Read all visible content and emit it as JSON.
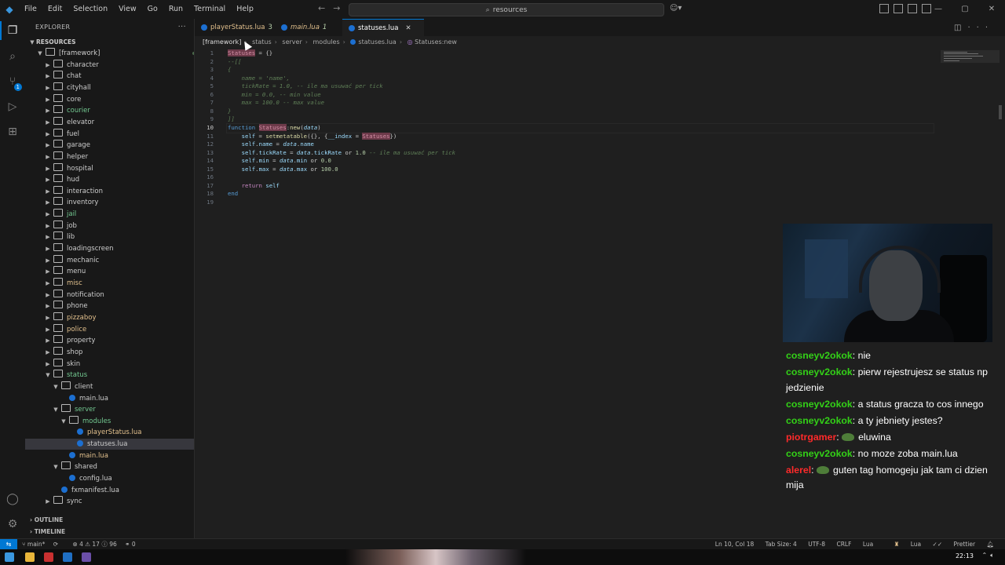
{
  "menu": [
    "File",
    "Edit",
    "Selection",
    "View",
    "Go",
    "Run",
    "Terminal",
    "Help"
  ],
  "command_center": {
    "label": "resources"
  },
  "explorer": {
    "title": "EXPLORER",
    "root": "RESOURCES",
    "items": [
      {
        "label": "[framework]",
        "type": "folder",
        "open": true,
        "depth": 1,
        "dot": true
      },
      {
        "label": "character",
        "type": "folder",
        "depth": 2
      },
      {
        "label": "chat",
        "type": "folder",
        "depth": 2
      },
      {
        "label": "cityhall",
        "type": "folder",
        "depth": 2
      },
      {
        "label": "core",
        "type": "folder",
        "depth": 2
      },
      {
        "label": "courier",
        "type": "folder",
        "depth": 2,
        "dot": true
      },
      {
        "label": "elevator",
        "type": "folder",
        "depth": 2
      },
      {
        "label": "fuel",
        "type": "folder",
        "depth": 2
      },
      {
        "label": "garage",
        "type": "folder",
        "depth": 2
      },
      {
        "label": "helper",
        "type": "folder",
        "depth": 2
      },
      {
        "label": "hospital",
        "type": "folder",
        "depth": 2
      },
      {
        "label": "hud",
        "type": "folder",
        "depth": 2
      },
      {
        "label": "interaction",
        "type": "folder",
        "depth": 2
      },
      {
        "label": "inventory",
        "type": "folder",
        "depth": 2
      },
      {
        "label": "jail",
        "type": "folder",
        "depth": 2,
        "dot": true
      },
      {
        "label": "job",
        "type": "folder",
        "depth": 2
      },
      {
        "label": "lib",
        "type": "folder",
        "depth": 2
      },
      {
        "label": "loadingscreen",
        "type": "folder",
        "depth": 2
      },
      {
        "label": "mechanic",
        "type": "folder",
        "depth": 2
      },
      {
        "label": "menu",
        "type": "folder",
        "depth": 2
      },
      {
        "label": "misc",
        "type": "folder",
        "depth": 2,
        "dot": true
      },
      {
        "label": "notification",
        "type": "folder",
        "depth": 2
      },
      {
        "label": "phone",
        "type": "folder",
        "depth": 2
      },
      {
        "label": "pizzaboy",
        "type": "folder",
        "depth": 2,
        "dot": true
      },
      {
        "label": "police",
        "type": "folder",
        "depth": 2,
        "dot": true
      },
      {
        "label": "property",
        "type": "folder",
        "depth": 2
      },
      {
        "label": "shop",
        "type": "folder",
        "depth": 2
      },
      {
        "label": "skin",
        "type": "folder",
        "depth": 2
      },
      {
        "label": "status",
        "type": "folder",
        "open": true,
        "depth": 2,
        "dot": true
      },
      {
        "label": "client",
        "type": "folder",
        "open": true,
        "depth": 3
      },
      {
        "label": "main.lua",
        "type": "file",
        "depth": 4
      },
      {
        "label": "server",
        "type": "folder",
        "open": true,
        "depth": 3,
        "dot": true
      },
      {
        "label": "modules",
        "type": "folder",
        "open": true,
        "depth": 4,
        "dot": true
      },
      {
        "label": "playerStatus.lua",
        "type": "file",
        "depth": 5,
        "count": "3"
      },
      {
        "label": "statuses.lua",
        "type": "file",
        "depth": 5,
        "selected": true
      },
      {
        "label": "main.lua",
        "type": "file",
        "depth": 4,
        "count": "1"
      },
      {
        "label": "shared",
        "type": "folder",
        "open": true,
        "depth": 3
      },
      {
        "label": "config.lua",
        "type": "file",
        "depth": 4
      },
      {
        "label": "fxmanifest.lua",
        "type": "file",
        "depth": 3
      },
      {
        "label": "sync",
        "type": "folder",
        "depth": 2
      }
    ],
    "outline": "OUTLINE",
    "timeline": "TIMELINE"
  },
  "tabs": [
    {
      "label": "playerStatus.lua",
      "count": "3"
    },
    {
      "label": "main.lua",
      "count": "1"
    },
    {
      "label": "statuses.lua",
      "active": true
    }
  ],
  "breadcrumb": [
    "[framework]",
    "status",
    "server",
    "modules",
    "statuses.lua",
    "Statuses:new"
  ],
  "code": [
    {
      "n": "1"
    },
    {
      "n": "2"
    },
    {
      "n": "3"
    },
    {
      "n": "4"
    },
    {
      "n": "5"
    },
    {
      "n": "6"
    },
    {
      "n": "7"
    },
    {
      "n": "8"
    },
    {
      "n": "9"
    },
    {
      "n": "10",
      "current": true
    },
    {
      "n": "11"
    },
    {
      "n": "12"
    },
    {
      "n": "13"
    },
    {
      "n": "14"
    },
    {
      "n": "15"
    },
    {
      "n": "16"
    },
    {
      "n": "17"
    },
    {
      "n": "18"
    },
    {
      "n": "19"
    }
  ],
  "chat": [
    {
      "user": "cosneyv2okok",
      "color": "#33d117",
      "text": "nie"
    },
    {
      "user": "cosneyv2okok",
      "color": "#33d117",
      "text": "pierw rejestrujesz se status np jedzienie"
    },
    {
      "user": "cosneyv2okok",
      "color": "#33d117",
      "text": "a status gracza to cos innego"
    },
    {
      "user": "cosneyv2okok",
      "color": "#33d117",
      "text": "a ty jebniety jestes?"
    },
    {
      "user": "piotrgamer",
      "color": "#ff2a2a",
      "text": "eluwina",
      "emote": true
    },
    {
      "user": "cosneyv2okok",
      "color": "#33d117",
      "text": "no moze zoba main.lua"
    },
    {
      "user": "alerel",
      "color": "#ff2a2a",
      "text": "guten tag homogeju jak tam ci dzien mija",
      "emote": true
    }
  ],
  "status": {
    "branch": "main*",
    "problems": "⊗ 4 ⚠ 17 ⓘ 96",
    "ports": "⚭ 0",
    "position": "Ln 10, Col 18",
    "tab_size": "Tab Size: 4",
    "encoding": "UTF-8",
    "eol": "CRLF",
    "language": "Lua",
    "lang_tag": "Lua",
    "formatter": "Prettier"
  },
  "taskbar": {
    "clock": "22:13"
  }
}
